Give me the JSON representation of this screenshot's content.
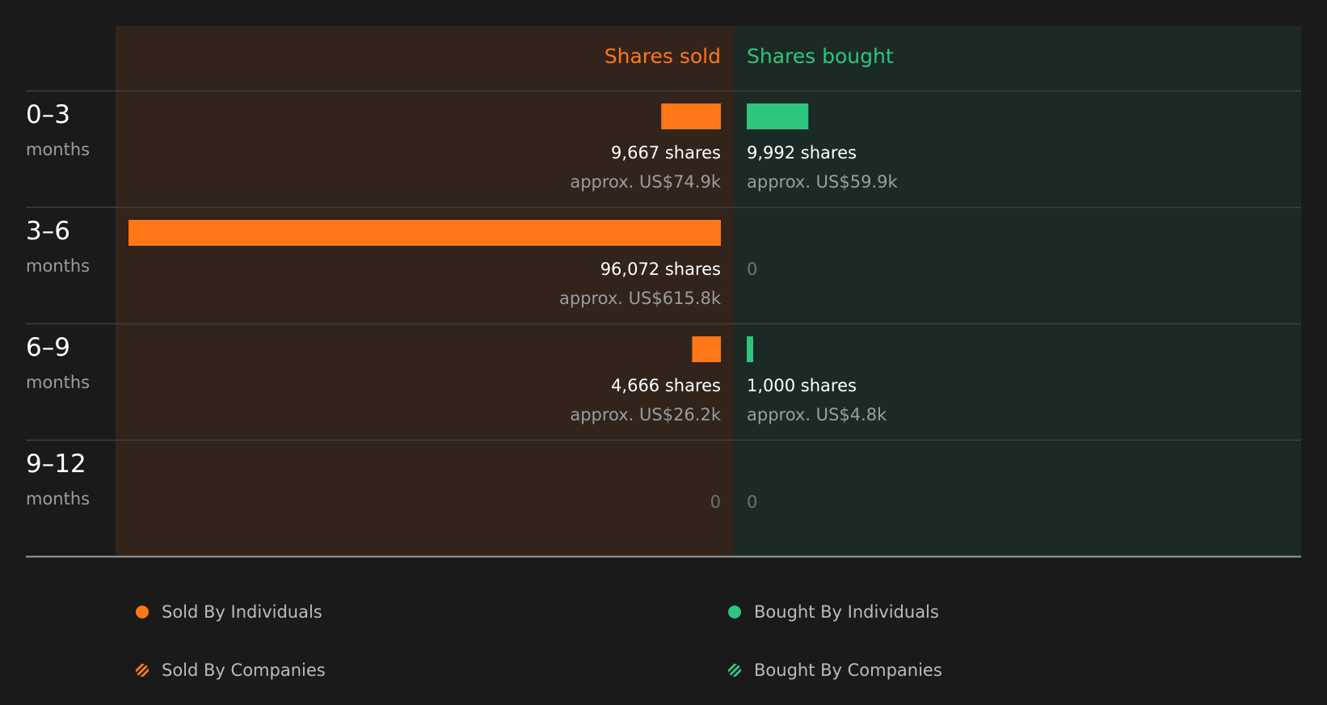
{
  "chart_data": {
    "type": "bar",
    "orientation": "horizontal-diverging",
    "columns": {
      "sold_label": "Shares sold",
      "bought_label": "Shares bought"
    },
    "categories": [
      {
        "top": "0–3",
        "bottom": "months"
      },
      {
        "top": "3–6",
        "bottom": "months"
      },
      {
        "top": "6–9",
        "bottom": "months"
      },
      {
        "top": "9–12",
        "bottom": "months"
      }
    ],
    "series": [
      {
        "name": "Shares sold",
        "values": [
          9667,
          96072,
          4666,
          0
        ],
        "value_labels": [
          "9,667 shares",
          "96,072 shares",
          "4,666 shares",
          "0"
        ],
        "approx_labels": [
          "approx. US$74.9k",
          "approx. US$615.8k",
          "approx. US$26.2k",
          ""
        ]
      },
      {
        "name": "Shares bought",
        "values": [
          9992,
          0,
          1000,
          0
        ],
        "value_labels": [
          "9,992 shares",
          "0",
          "1,000 shares",
          "0"
        ],
        "approx_labels": [
          "approx. US$59.9k",
          "",
          "approx. US$4.8k",
          ""
        ]
      }
    ],
    "xlim": [
      0,
      96072
    ],
    "colors": {
      "sold": "#ff7717",
      "bought": "#2ec57e",
      "sold_bg": "#32231b",
      "bought_bg": "#1b2a24",
      "background": "#1a1a1a"
    },
    "legend": [
      {
        "label": "Sold By Individuals",
        "swatch": "sold-solid"
      },
      {
        "label": "Bought By Individuals",
        "swatch": "bought-solid"
      },
      {
        "label": "Sold By Companies",
        "swatch": "sold-striped"
      },
      {
        "label": "Bought By Companies",
        "swatch": "bought-striped"
      }
    ]
  }
}
